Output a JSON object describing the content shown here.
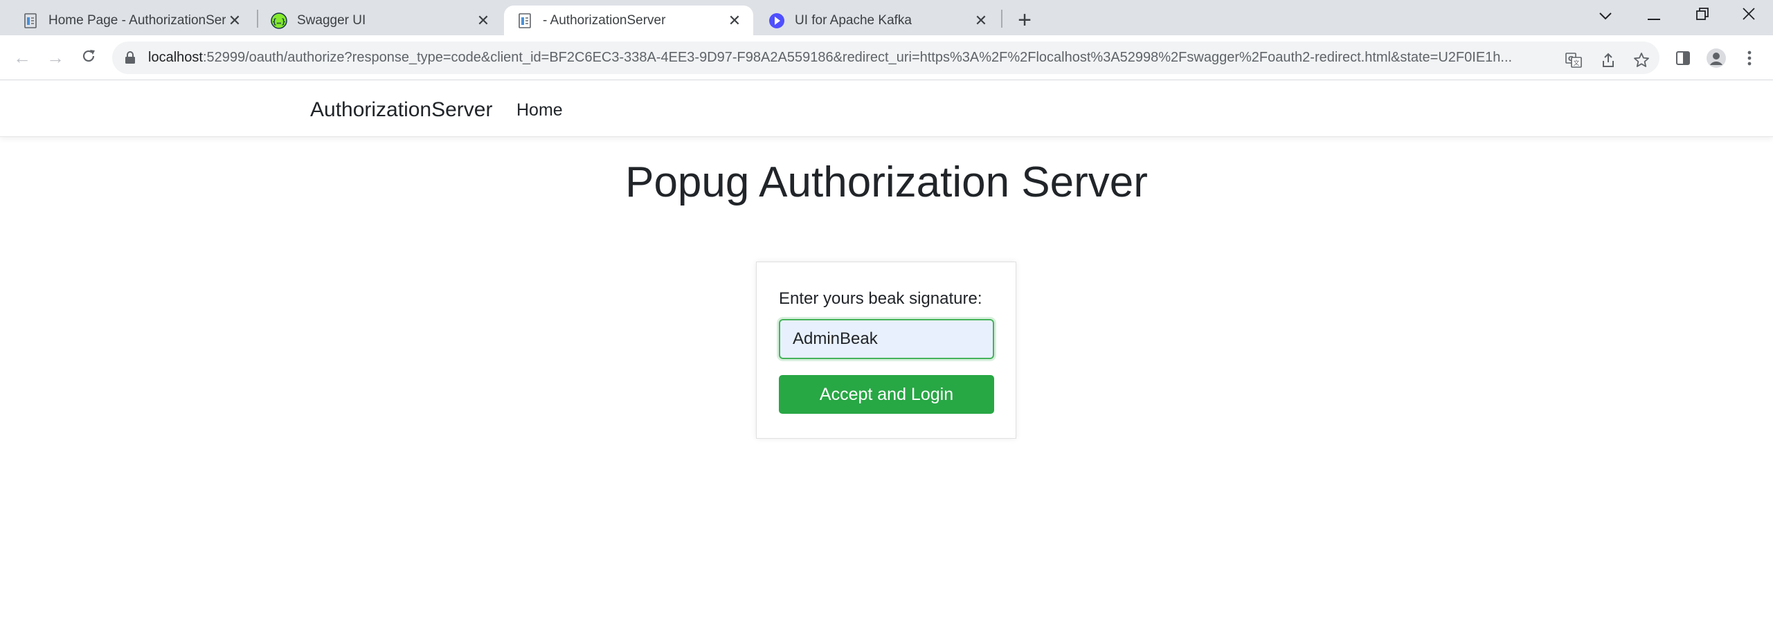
{
  "browser": {
    "tabs": [
      {
        "title": "Home Page - AuthorizationServer",
        "icon": "document-icon",
        "active": false
      },
      {
        "title": "Swagger UI",
        "icon": "swagger-icon",
        "active": false
      },
      {
        "title": "- AuthorizationServer",
        "icon": "document-icon",
        "active": true
      },
      {
        "title": "UI for Apache Kafka",
        "icon": "kafka-ui-icon",
        "active": false
      }
    ],
    "new_tab_glyph": "+",
    "url_host": "localhost",
    "url_rest": ":52999/oauth/authorize?response_type=code&client_id=BF2C6EC3-338A-4EE3-9D97-F98A2A559186&redirect_uri=https%3A%2F%2Flocalhost%3A52998%2Fswagger%2Foauth2-redirect.html&state=U2F0IE1h..."
  },
  "site": {
    "brand": "AuthorizationServer",
    "nav_home": "Home"
  },
  "main": {
    "title": "Popug Authorization Server",
    "form": {
      "label": "Enter yours beak signature:",
      "input_value": "AdminBeak",
      "submit_label": "Accept and Login"
    }
  },
  "colors": {
    "accent_green": "#28a745",
    "input_bg": "#e8f0fe",
    "tabstrip_bg": "#dee1e6"
  }
}
